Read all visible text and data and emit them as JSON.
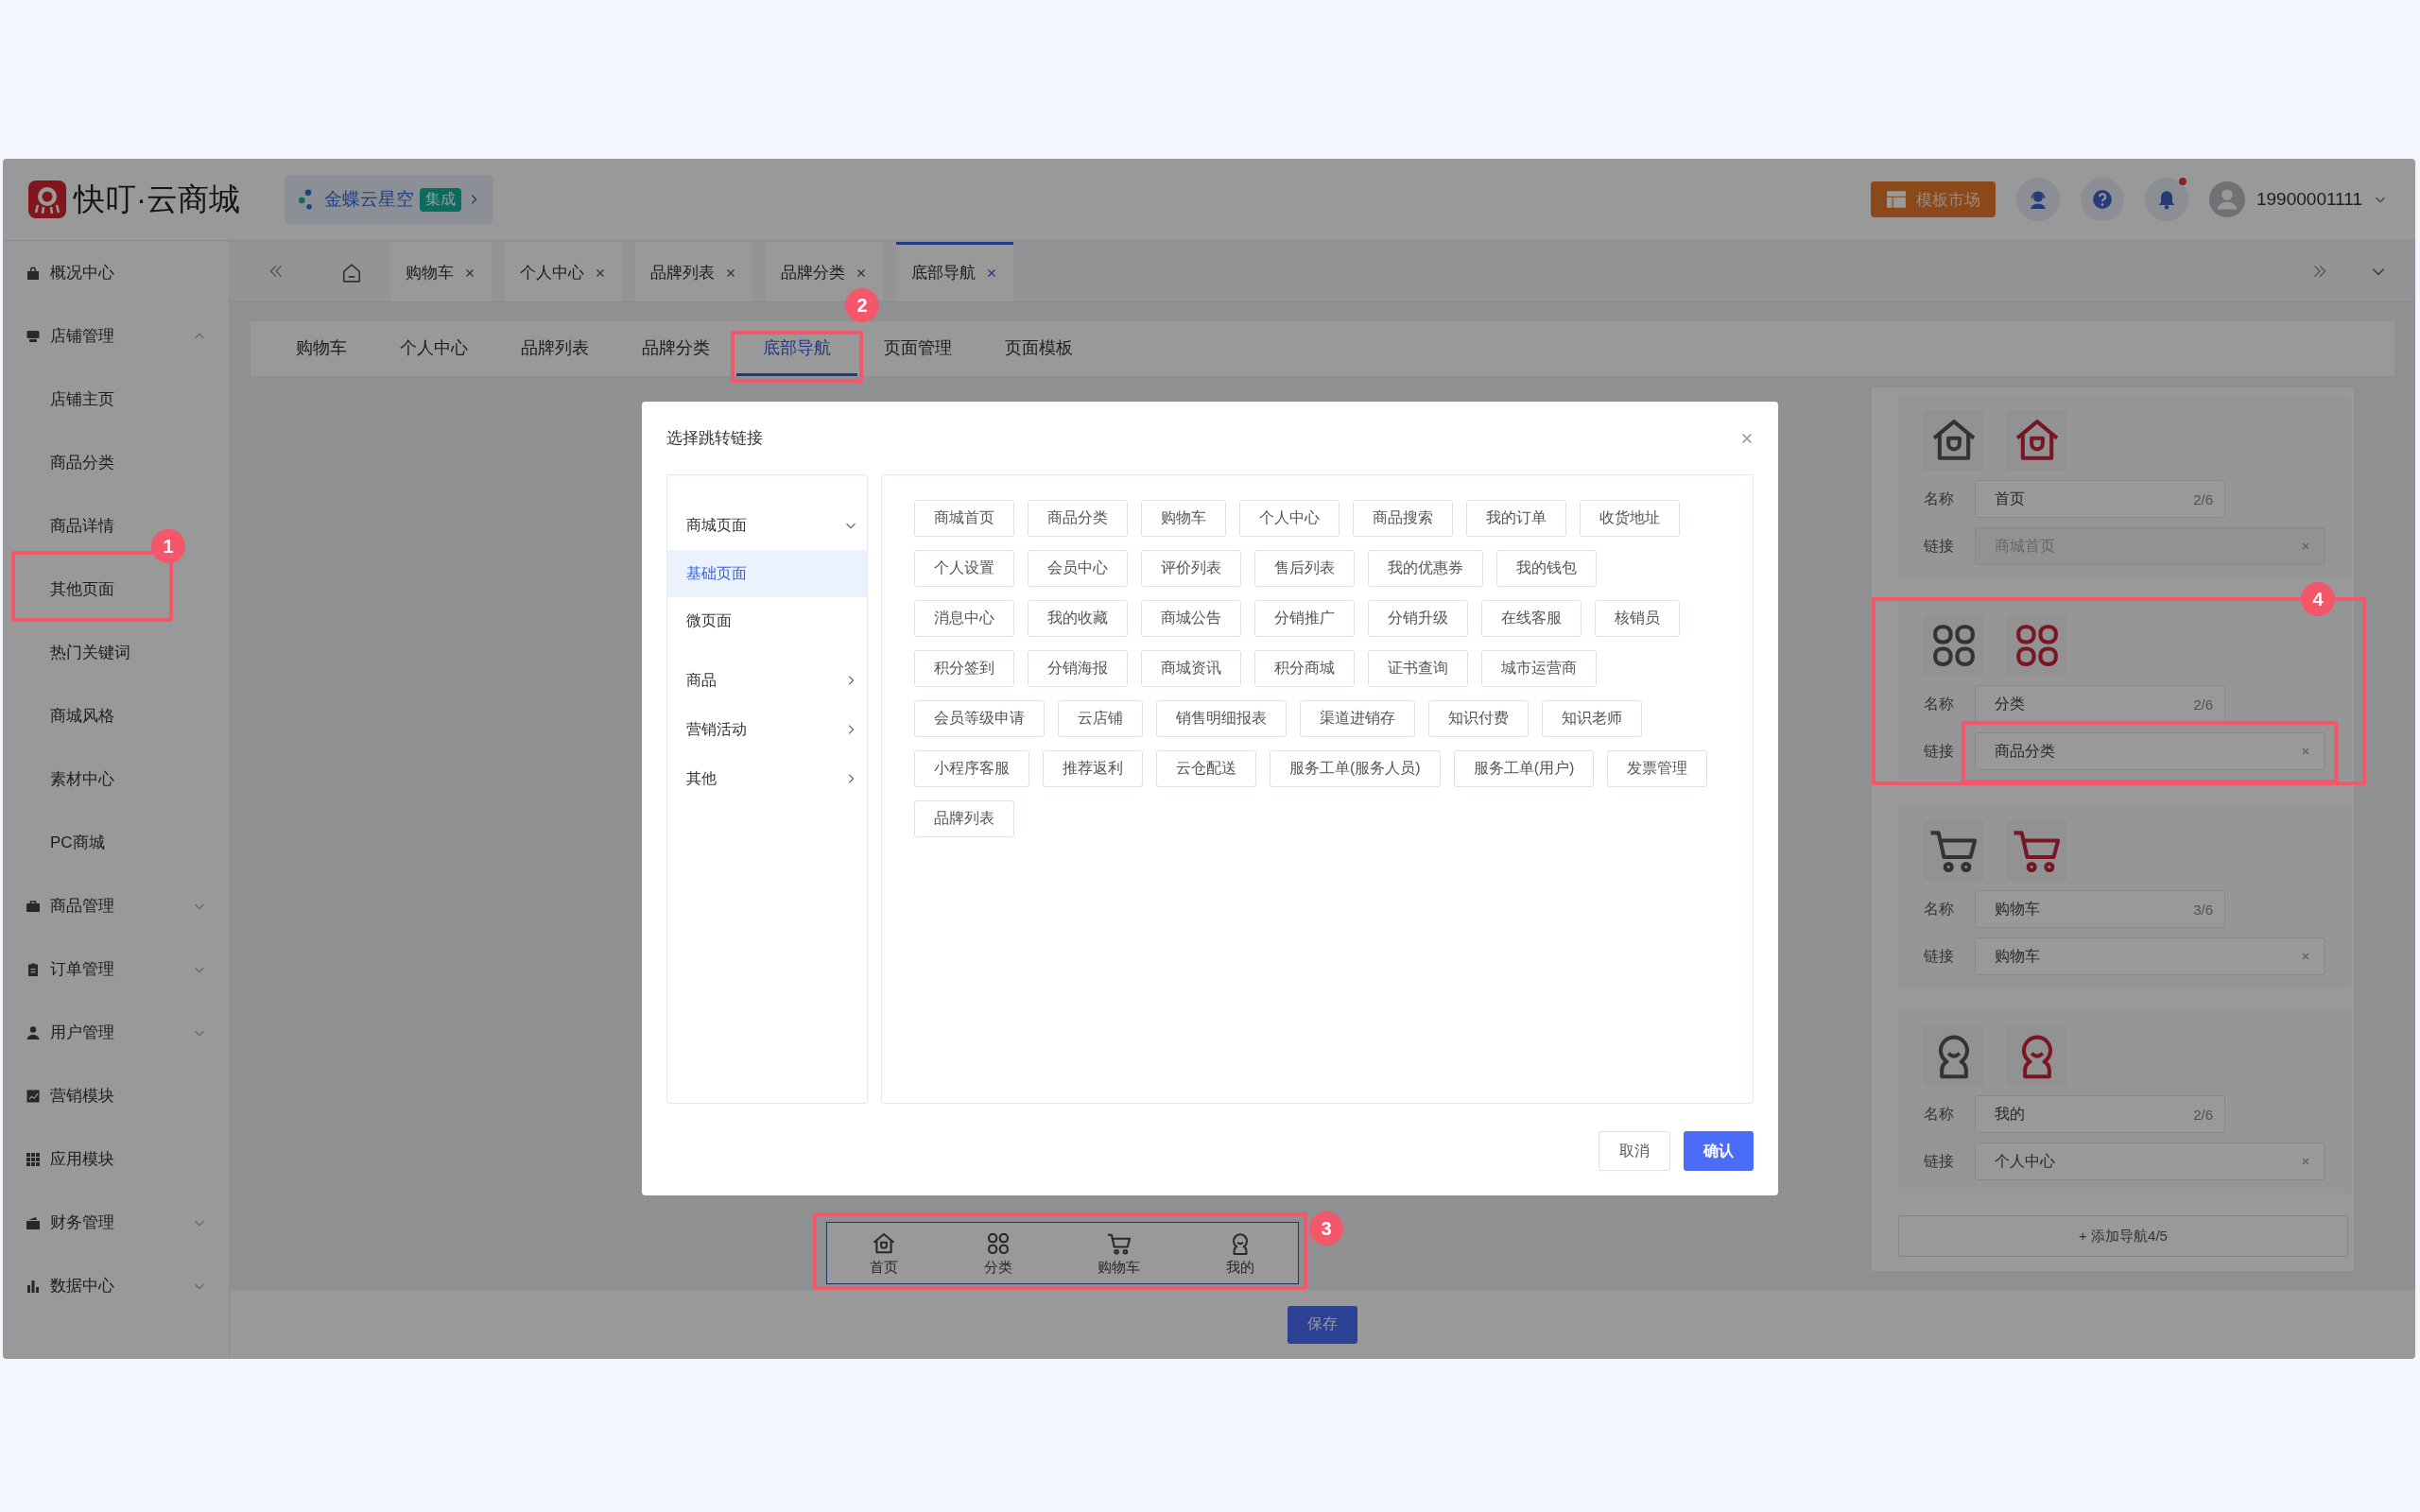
{
  "header": {
    "logo_text": "快叮·云商城",
    "integration": {
      "label": "金蝶云星空",
      "tag": "集成"
    },
    "template_button": "模板市场",
    "has_unread": true,
    "user": "19900001111"
  },
  "sidebar": {
    "items": [
      {
        "label": "概况中心"
      },
      {
        "label": "店铺管理",
        "expanded": true,
        "children": [
          {
            "label": "店铺主页"
          },
          {
            "label": "商品分类"
          },
          {
            "label": "商品详情"
          },
          {
            "label": "其他页面"
          },
          {
            "label": "热门关键词"
          },
          {
            "label": "商城风格"
          },
          {
            "label": "素材中心"
          },
          {
            "label": "PC商城"
          }
        ]
      },
      {
        "label": "商品管理",
        "expanded": false
      },
      {
        "label": "订单管理",
        "expanded": false
      },
      {
        "label": "用户管理",
        "expanded": false
      },
      {
        "label": "营销模块"
      },
      {
        "label": "应用模块"
      },
      {
        "label": "财务管理",
        "expanded": false
      },
      {
        "label": "数据中心",
        "expanded": false
      }
    ]
  },
  "tabs": [
    {
      "label": "购物车",
      "selected": false
    },
    {
      "label": "个人中心",
      "selected": false
    },
    {
      "label": "品牌列表",
      "selected": false
    },
    {
      "label": "品牌分类",
      "selected": false
    },
    {
      "label": "底部导航",
      "selected": true
    }
  ],
  "page_tabs": [
    {
      "label": "购物车",
      "selected": false
    },
    {
      "label": "个人中心",
      "selected": false
    },
    {
      "label": "品牌列表",
      "selected": false
    },
    {
      "label": "品牌分类",
      "selected": false
    },
    {
      "label": "底部导航",
      "selected": true
    },
    {
      "label": "页面管理",
      "selected": false
    },
    {
      "label": "页面模板",
      "selected": false
    }
  ],
  "preview_nav": [
    {
      "label": "首页"
    },
    {
      "label": "分类"
    },
    {
      "label": "购物车"
    },
    {
      "label": "我的"
    }
  ],
  "nav_items": [
    {
      "name_label": "名称",
      "name": "首页",
      "count": "2/6",
      "link_label": "链接",
      "link": "商城首页",
      "link_disabled": true
    },
    {
      "name_label": "名称",
      "name": "分类",
      "count": "2/6",
      "link_label": "链接",
      "link": "商品分类",
      "link_disabled": false
    },
    {
      "name_label": "名称",
      "name": "购物车",
      "count": "3/6",
      "link_label": "链接",
      "link": "购物车",
      "link_disabled": false
    },
    {
      "name_label": "名称",
      "name": "我的",
      "count": "2/6",
      "link_label": "链接",
      "link": "个人中心",
      "link_disabled": false
    }
  ],
  "add_button": "+ 添加导航4/5",
  "save_button": "保存",
  "modal": {
    "title": "选择跳转链接",
    "menu": [
      {
        "label": "商城页面",
        "expanded": true,
        "children": [
          {
            "label": "基础页面",
            "selected": true
          },
          {
            "label": "微页面",
            "selected": false
          }
        ]
      },
      {
        "label": "商品",
        "expanded": false
      },
      {
        "label": "营销活动",
        "expanded": false
      },
      {
        "label": "其他",
        "expanded": false
      }
    ],
    "link_rows": [
      [
        "商城首页",
        "商品分类",
        "购物车",
        "个人中心",
        "商品搜索",
        "我的订单",
        "收货地址"
      ],
      [
        "个人设置",
        "会员中心",
        "评价列表",
        "售后列表",
        "我的优惠券",
        "我的钱包"
      ],
      [
        "消息中心",
        "我的收藏",
        "商城公告",
        "分销推广",
        "分销升级",
        "在线客服",
        "核销员"
      ],
      [
        "积分签到",
        "分销海报",
        "商城资讯",
        "积分商城",
        "证书查询",
        "城市运营商"
      ],
      [
        "会员等级申请",
        "云店铺",
        "销售明细报表",
        "渠道进销存",
        "知识付费",
        "知识老师"
      ],
      [
        "小程序客服",
        "推荐返利",
        "云仓配送",
        "服务工单(服务人员)",
        "服务工单(用户)",
        "发票管理"
      ],
      [
        "品牌列表"
      ]
    ],
    "cancel": "取消",
    "confirm": "确认"
  },
  "callouts": [
    {
      "label": "1"
    },
    {
      "label": "2"
    },
    {
      "label": "3"
    },
    {
      "label": "4"
    }
  ]
}
